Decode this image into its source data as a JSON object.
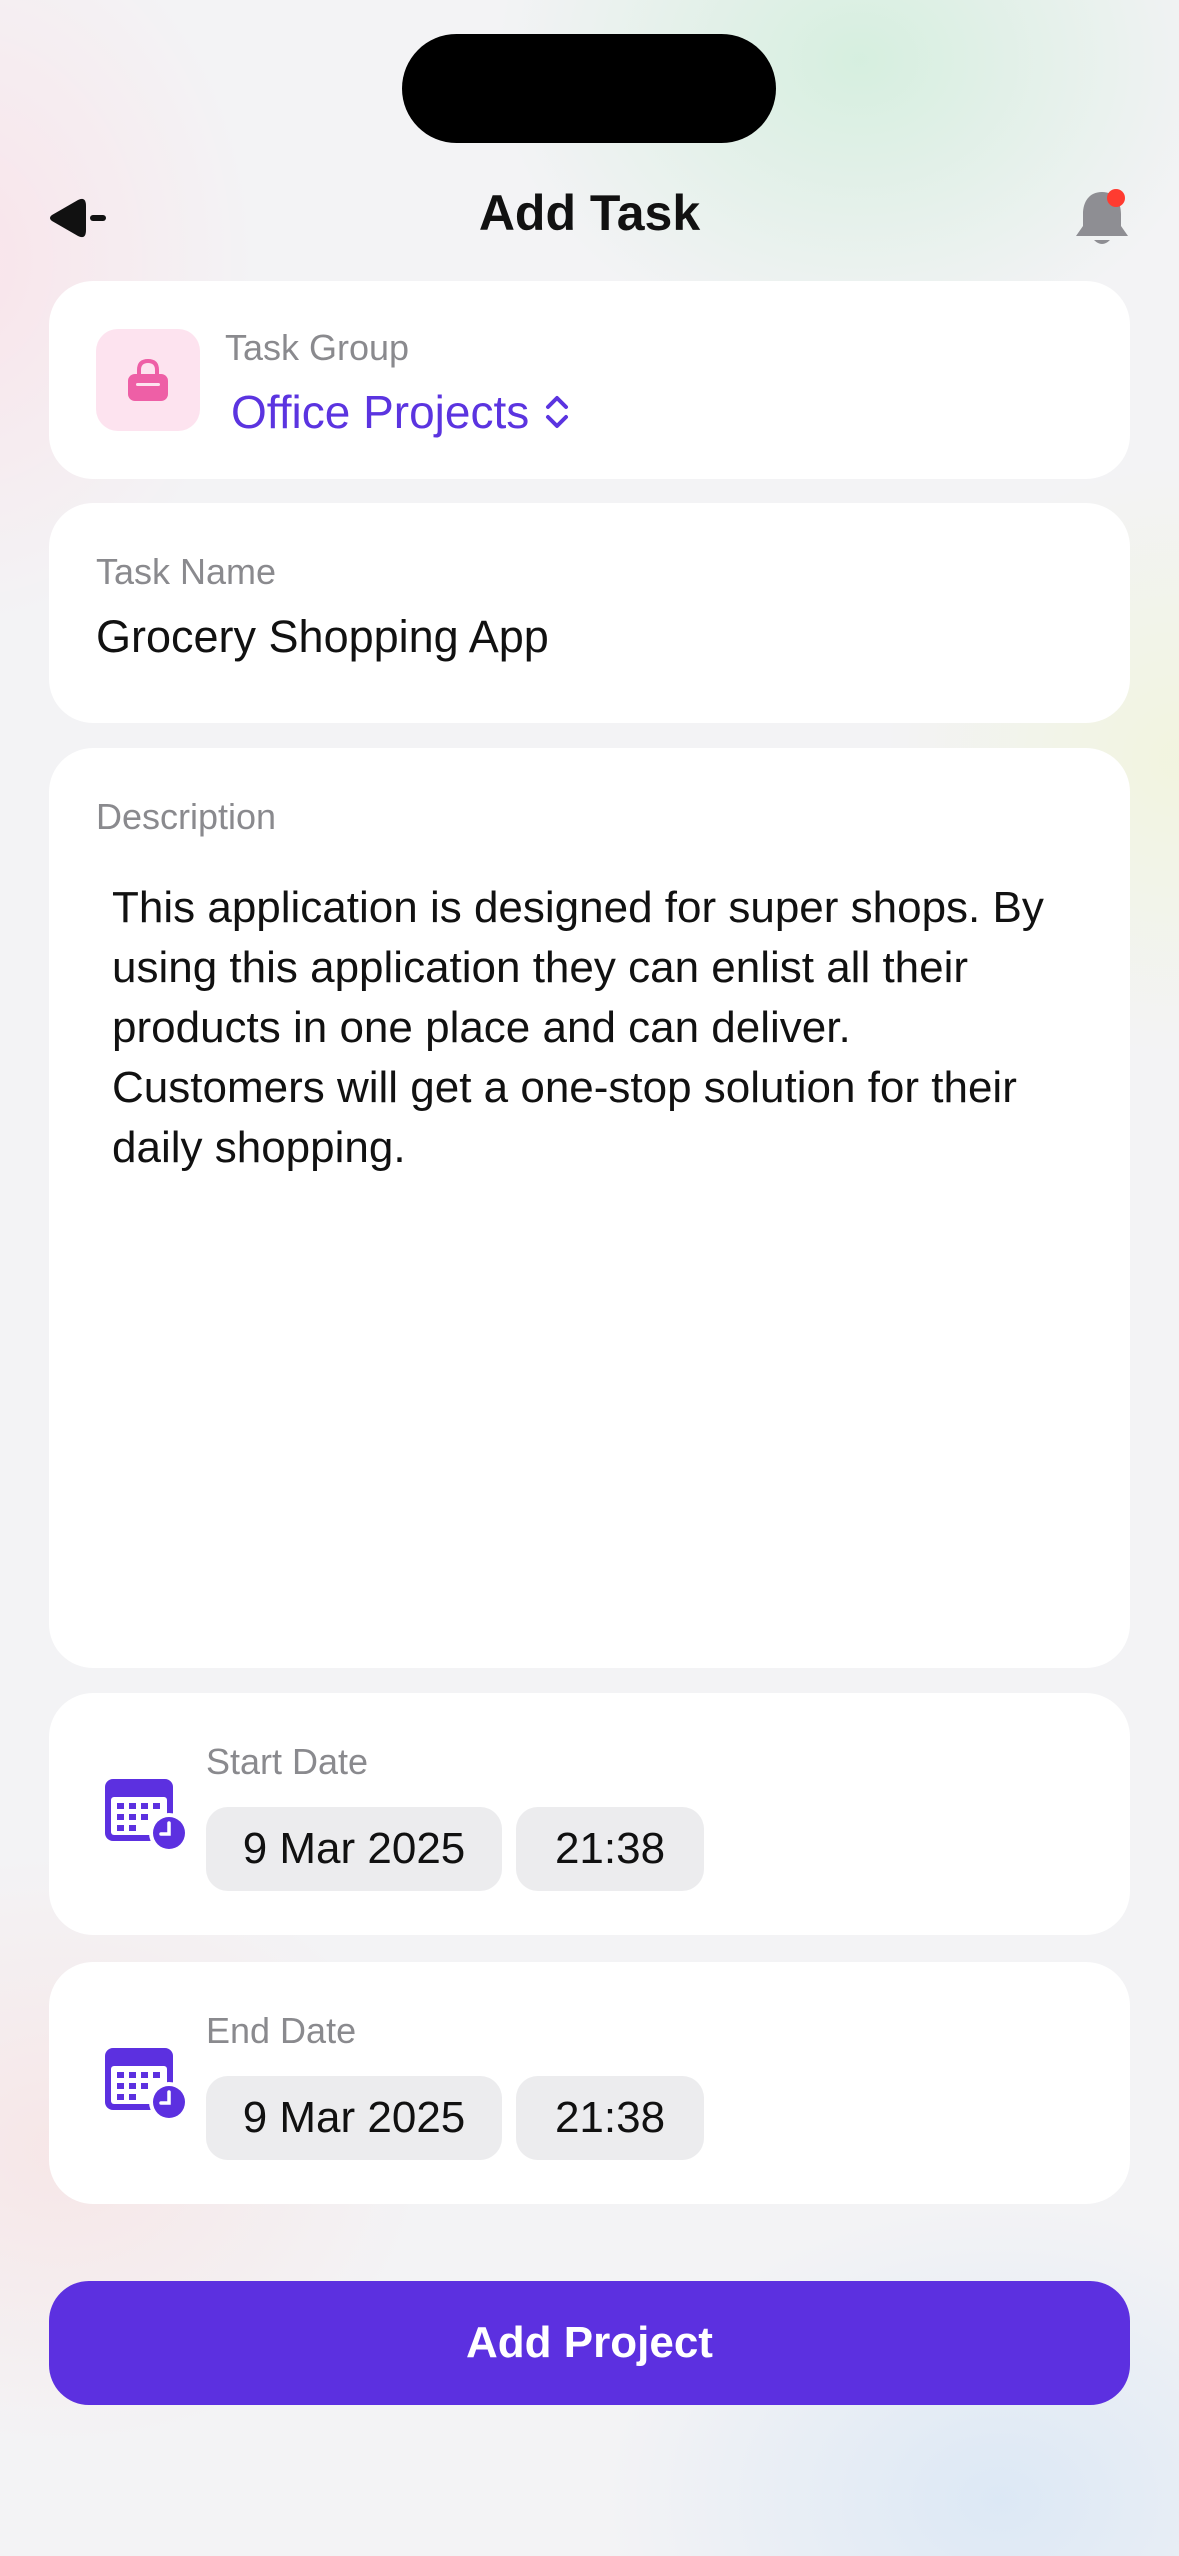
{
  "header": {
    "title": "Add Task"
  },
  "task_group": {
    "label": "Task Group",
    "value": "Office Projects",
    "icon": "handbag-icon",
    "icon_bg": "#fde3ef",
    "icon_color": "#ee5fa6"
  },
  "task_name": {
    "label": "Task Name",
    "value": "Grocery Shopping App"
  },
  "description": {
    "label": "Description",
    "value": "This application is designed for super shops. By using this application they can enlist all their products in one place and can deliver. Customers will get a one-stop solution for their daily shopping."
  },
  "start": {
    "label": "Start Date",
    "date": "9 Mar 2025",
    "time": "21:38"
  },
  "end": {
    "label": "End Date",
    "date": "9 Mar 2025",
    "time": "21:38"
  },
  "submit_label": "Add Project",
  "colors": {
    "accent": "#5c30e0",
    "notification_dot": "#ff3b30"
  }
}
